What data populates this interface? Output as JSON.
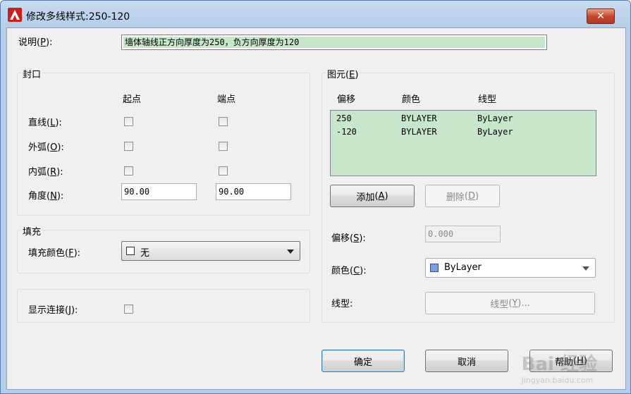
{
  "window": {
    "title": "修改多线样式:250-120",
    "close": "✕"
  },
  "description": {
    "label": "说明",
    "hotkey": "P",
    "value": "墙体轴线正方向厚度为250，负方向厚度为120"
  },
  "caps": {
    "title": "封口",
    "col_start": "起点",
    "col_end": "端点",
    "line": {
      "label": "直线",
      "hotkey": "L"
    },
    "outer_arc": {
      "label": "外弧",
      "hotkey": "O"
    },
    "inner_arc": {
      "label": "内弧",
      "hotkey": "R"
    },
    "angle": {
      "label": "角度",
      "hotkey": "N",
      "start": "90.00",
      "end": "90.00"
    }
  },
  "fill": {
    "title": "填充",
    "label": "填充颜色",
    "hotkey": "F",
    "value": "无"
  },
  "joints": {
    "label": "显示连接",
    "hotkey": "J"
  },
  "elements": {
    "title": "图元",
    "hotkey": "E",
    "headers": [
      "偏移",
      "颜色",
      "线型"
    ],
    "rows": [
      [
        "250",
        "BYLAYER",
        "ByLayer"
      ],
      [
        "-120",
        "BYLAYER",
        "ByLayer"
      ]
    ],
    "add": {
      "label": "添加",
      "hotkey": "A"
    },
    "delete": {
      "label": "删除",
      "hotkey": "D"
    },
    "offset": {
      "label": "偏移",
      "hotkey": "S",
      "value": "0.000"
    },
    "color": {
      "label": "颜色",
      "hotkey": "C",
      "value": "ByLayer",
      "swatch": "#7f9de0"
    },
    "linetype": {
      "label": "线型:",
      "button": "线型",
      "hotkey": "Y",
      "ellipsis": "..."
    }
  },
  "buttons": {
    "ok": "确定",
    "cancel": "取消",
    "help": "帮助",
    "help_hotkey": "H"
  },
  "watermark": {
    "main": "Bai 经验",
    "sub": "jingyan.baidu.com"
  }
}
